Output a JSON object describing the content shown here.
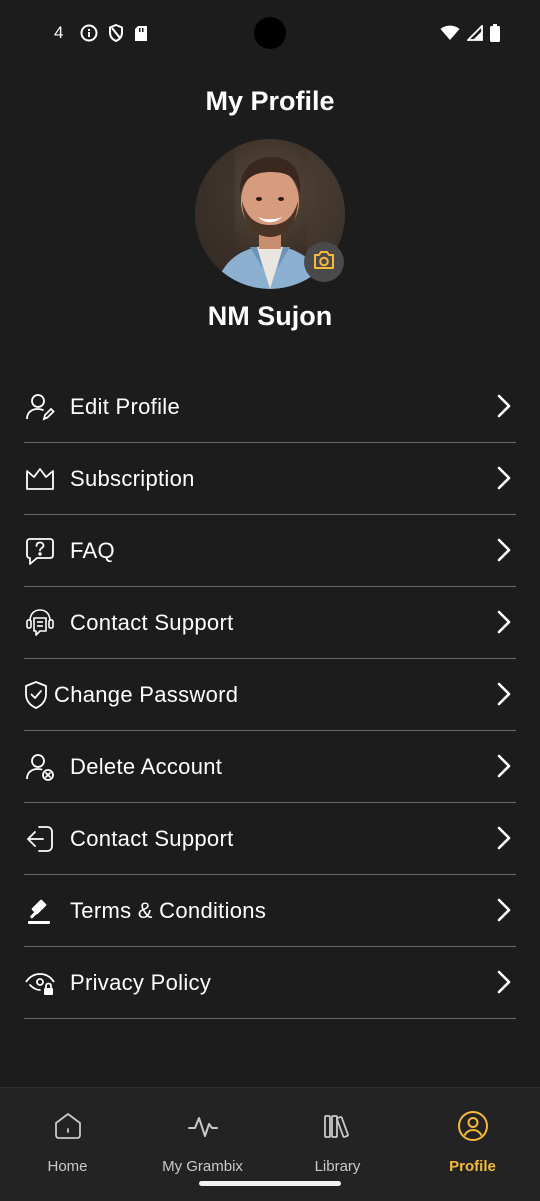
{
  "status_bar": {
    "time": "4"
  },
  "header": {
    "title": "My Profile"
  },
  "profile": {
    "name": "NM Sujon"
  },
  "menu": {
    "items": [
      {
        "label": "Edit Profile",
        "icon": "user-edit-icon"
      },
      {
        "label": "Subscription",
        "icon": "crown-icon"
      },
      {
        "label": "FAQ",
        "icon": "question-bubble-icon"
      },
      {
        "label": "Contact Support",
        "icon": "support-agent-icon"
      },
      {
        "label": "Change Password",
        "icon": "shield-check-icon"
      },
      {
        "label": "Delete Account",
        "icon": "user-delete-icon"
      },
      {
        "label": "Contact Support",
        "icon": "logout-icon"
      },
      {
        "label": "Terms & Conditions",
        "icon": "gavel-icon"
      },
      {
        "label": "Privacy Policy",
        "icon": "eye-lock-icon"
      }
    ]
  },
  "bottom_nav": {
    "items": [
      {
        "label": "Home",
        "icon": "home-icon"
      },
      {
        "label": "My Grambix",
        "icon": "activity-icon"
      },
      {
        "label": "Library",
        "icon": "library-icon"
      },
      {
        "label": "Profile",
        "icon": "profile-icon",
        "active": true
      }
    ]
  },
  "colors": {
    "background": "#1c1c1c",
    "accent": "#f6b93b",
    "divider": "#6a6a6a",
    "nav_background": "#232323"
  }
}
